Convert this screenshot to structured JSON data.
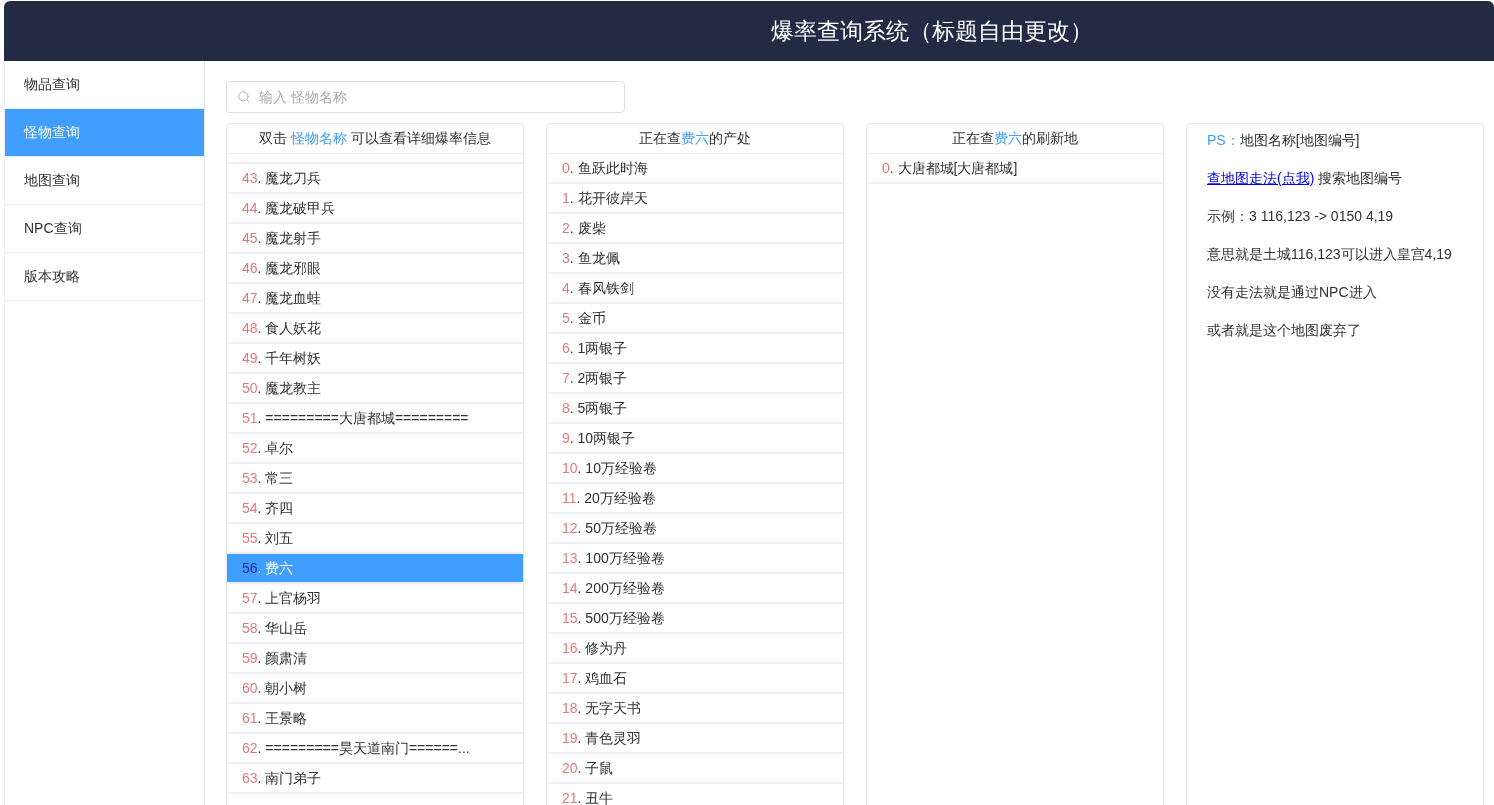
{
  "header": {
    "title": "爆率查询系统（标题自由更改）"
  },
  "sidebar": {
    "items": [
      {
        "label": "物品查询",
        "selected": false
      },
      {
        "label": "怪物查询",
        "selected": true
      },
      {
        "label": "地图查询",
        "selected": false
      },
      {
        "label": "NPC查询",
        "selected": false
      },
      {
        "label": "版本攻略",
        "selected": false
      }
    ]
  },
  "search": {
    "placeholder": "输入 怪物名称"
  },
  "monster_list": {
    "heading": {
      "before": "双击 ",
      "highlight": "怪物名称",
      "after": " 可以查看详细爆率信息"
    },
    "items": [
      {
        "number": "43",
        "text": ". 魔龙刀兵",
        "selected": false
      },
      {
        "number": "44",
        "text": ". 魔龙破甲兵",
        "selected": false
      },
      {
        "number": "45",
        "text": ". 魔龙射手",
        "selected": false
      },
      {
        "number": "46",
        "text": ". 魔龙邪眼",
        "selected": false
      },
      {
        "number": "47",
        "text": ". 魔龙血蛙",
        "selected": false
      },
      {
        "number": "48",
        "text": ". 食人妖花",
        "selected": false
      },
      {
        "number": "49",
        "text": ". 千年树妖",
        "selected": false
      },
      {
        "number": "50",
        "text": ". 魔龙教主",
        "selected": false
      },
      {
        "number": "51",
        "text": ". =========大唐都城=========",
        "selected": false
      },
      {
        "number": "52",
        "text": ". 卓尔",
        "selected": false
      },
      {
        "number": "53",
        "text": ". 常三",
        "selected": false
      },
      {
        "number": "54",
        "text": ". 齐四",
        "selected": false
      },
      {
        "number": "55",
        "text": ". 刘五",
        "selected": false
      },
      {
        "number": "56",
        "text": ". 费六",
        "selected": true
      },
      {
        "number": "57",
        "text": ". 上官杨羽",
        "selected": false
      },
      {
        "number": "58",
        "text": ". 华山岳",
        "selected": false
      },
      {
        "number": "59",
        "text": ". 颜肃清",
        "selected": false
      },
      {
        "number": "60",
        "text": ". 朝小树",
        "selected": false
      },
      {
        "number": "61",
        "text": ". 王景略",
        "selected": false
      },
      {
        "number": "62",
        "text": ". =========昊天道南门======...",
        "selected": false
      },
      {
        "number": "63",
        "text": ". 南门弟子",
        "selected": false
      }
    ]
  },
  "drop_list": {
    "heading": {
      "before": "正在查",
      "highlight": "费六",
      "after": "的产处"
    },
    "items": [
      {
        "number": "0",
        "text": ". 鱼跃此时海"
      },
      {
        "number": "1",
        "text": ". 花开彼岸天"
      },
      {
        "number": "2",
        "text": ". 废柴"
      },
      {
        "number": "3",
        "text": ". 鱼龙佩"
      },
      {
        "number": "4",
        "text": ". 春风铁剑"
      },
      {
        "number": "5",
        "text": ". 金币"
      },
      {
        "number": "6",
        "text": ". 1两银子"
      },
      {
        "number": "7",
        "text": ". 2两银子"
      },
      {
        "number": "8",
        "text": ". 5两银子"
      },
      {
        "number": "9",
        "text": ". 10两银子"
      },
      {
        "number": "10",
        "text": ". 10万经验卷"
      },
      {
        "number": "11",
        "text": ". 20万经验卷"
      },
      {
        "number": "12",
        "text": ". 50万经验卷"
      },
      {
        "number": "13",
        "text": ". 100万经验卷"
      },
      {
        "number": "14",
        "text": ". 200万经验卷"
      },
      {
        "number": "15",
        "text": ". 500万经验卷"
      },
      {
        "number": "16",
        "text": ". 修为丹"
      },
      {
        "number": "17",
        "text": ". 鸡血石"
      },
      {
        "number": "18",
        "text": ". 无字天书"
      },
      {
        "number": "19",
        "text": ". 青色灵羽"
      },
      {
        "number": "20",
        "text": ". 子鼠"
      },
      {
        "number": "21",
        "text": ". 丑牛"
      }
    ]
  },
  "spawn_list": {
    "heading": {
      "before": "正在查",
      "highlight": "费六",
      "after": "的刷新地"
    },
    "items": [
      {
        "number": "0",
        "text": ". 大唐都城[大唐都城]"
      }
    ]
  },
  "info_panel": {
    "lines": [
      {
        "kind": "note",
        "label": "PS：",
        "text": "地图名称[地图编号]"
      },
      {
        "kind": "link",
        "link": "查地图走法(点我)",
        "text": " 搜索地图编号"
      },
      {
        "kind": "plain",
        "text": "示例：3 116,123 -> 0150 4,19"
      },
      {
        "kind": "plain",
        "text": "意思就是土城116,123可以进入皇宫4,19"
      },
      {
        "kind": "plain",
        "text": "没有走法就是通过NPC进入"
      },
      {
        "kind": "plain",
        "text": "或者就是这个地图废弃了"
      }
    ]
  }
}
